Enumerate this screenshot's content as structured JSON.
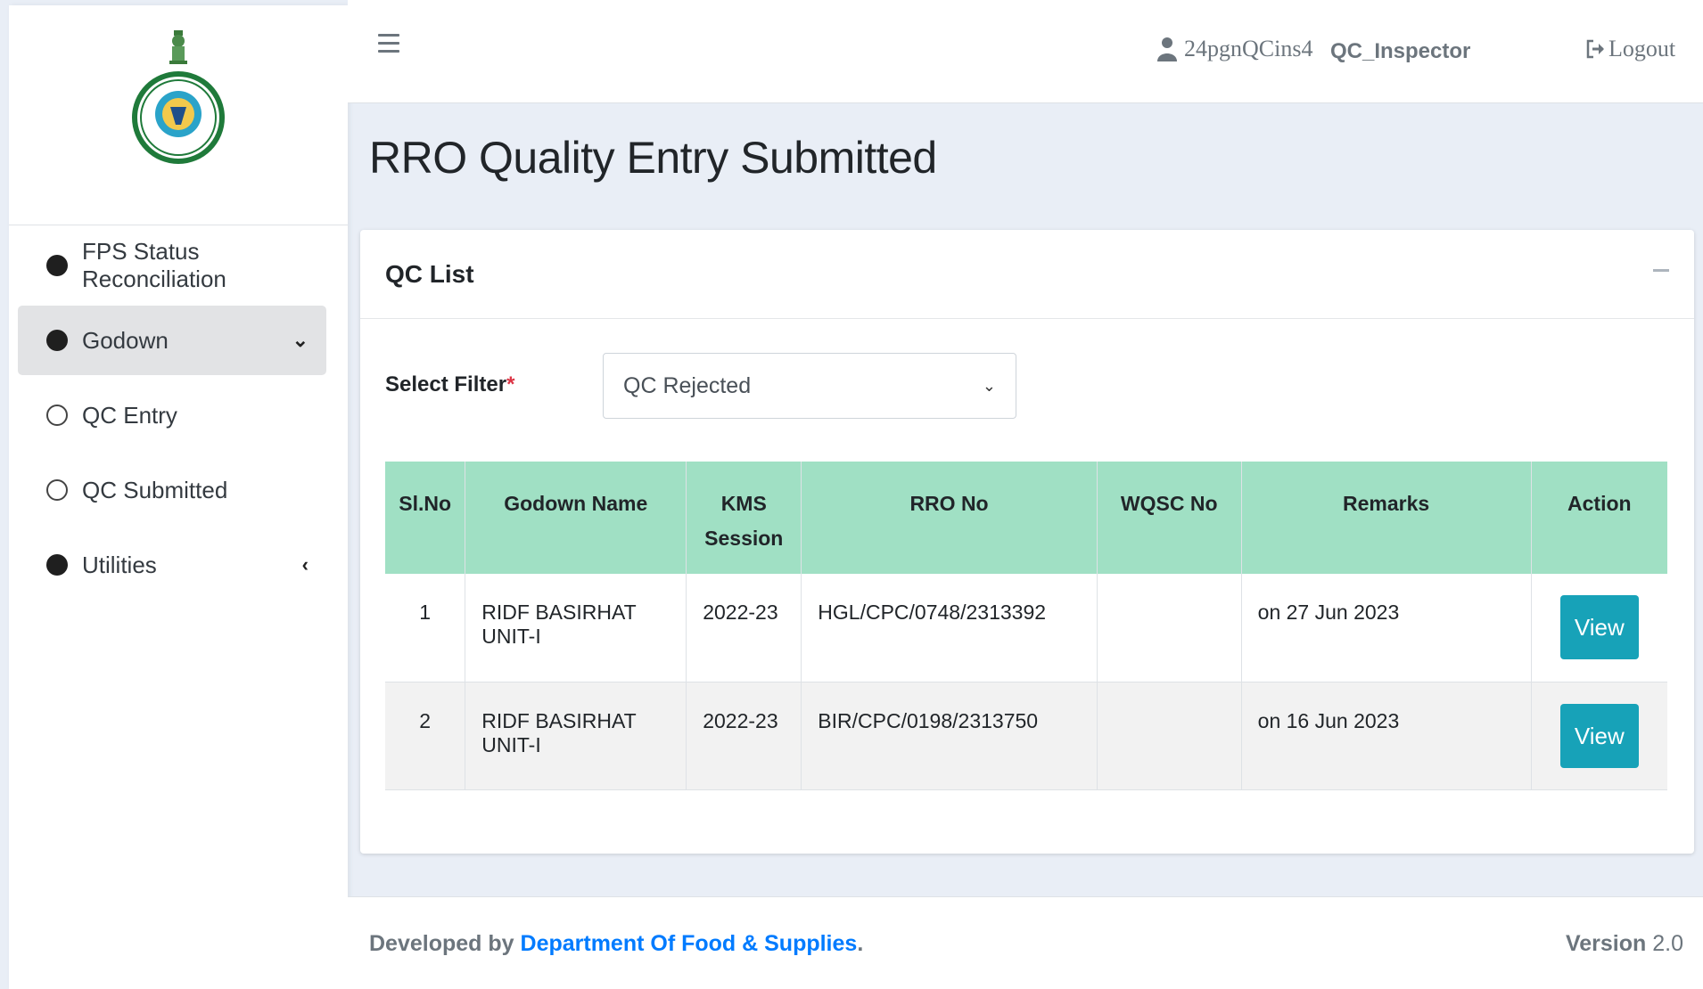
{
  "header": {
    "username": "24pgnQCins4",
    "role": "QC_Inspector",
    "logout_label": "Logout"
  },
  "sidebar": {
    "items": [
      {
        "label": "FPS Status Reconciliation",
        "icon": "filled-circle-icon"
      },
      {
        "label": "Godown",
        "icon": "filled-circle-icon",
        "active": true
      },
      {
        "label": "QC Entry",
        "icon": "outline-circle-icon"
      },
      {
        "label": "QC Submitted",
        "icon": "outline-circle-icon"
      },
      {
        "label": "Utilities",
        "icon": "filled-circle-icon"
      }
    ]
  },
  "main": {
    "page_title": "RRO Quality Entry Submitted",
    "card_title": "QC List",
    "filter_label": "Select Filter",
    "filter_required_mark": "*",
    "filter_value": "QC Rejected",
    "table": {
      "headers": [
        "Sl.No",
        "Godown Name",
        "KMS Session",
        "RRO No",
        "WQSC No",
        "Remarks",
        "Action"
      ],
      "rows": [
        {
          "sl": "1",
          "godown": "RIDF BASIRHAT UNIT-I",
          "kms": "2022-23",
          "rro": "HGL/CPC/0748/2313392",
          "wqsc": "",
          "remarks": "on 27 Jun 2023",
          "action": "View"
        },
        {
          "sl": "2",
          "godown": "RIDF BASIRHAT UNIT-I",
          "kms": "2022-23",
          "rro": "BIR/CPC/0198/2313750",
          "wqsc": "",
          "remarks": "on 16 Jun 2023",
          "action": "View"
        }
      ]
    }
  },
  "footer": {
    "developed_by": "Developed by",
    "dept": "Department Of Food & Supplies",
    "period": ".",
    "version_label": "Version",
    "version_value": "2.0"
  },
  "colors": {
    "table_header": "#a0e0c4",
    "view_button": "#17a2b8",
    "link": "#007bff"
  }
}
